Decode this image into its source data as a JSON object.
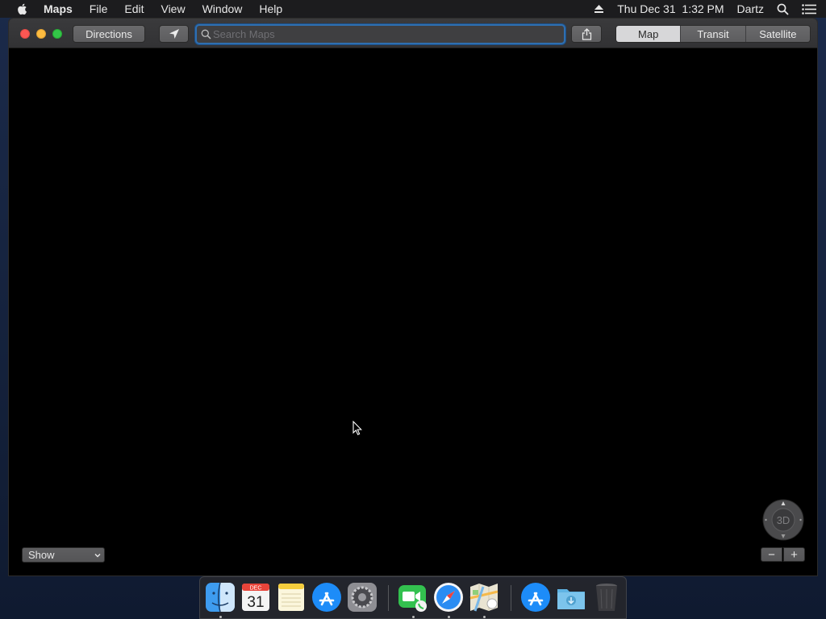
{
  "menubar": {
    "items": [
      "Maps",
      "File",
      "Edit",
      "View",
      "Window",
      "Help"
    ],
    "clock": "Thu Dec 31  1:32 PM",
    "user": "Dartz"
  },
  "toolbar": {
    "directions_label": "Directions",
    "search_placeholder": "Search Maps",
    "search_value": "",
    "view_modes": [
      "Map",
      "Transit",
      "Satellite"
    ],
    "active_view_mode": "Map"
  },
  "map": {
    "show_label": "Show",
    "compass_label": "3D",
    "zoom_out_label": "−",
    "zoom_in_label": "+"
  },
  "dock": {
    "calendar_month": "DEC",
    "calendar_day": "31",
    "apps": [
      "finder",
      "calendar",
      "notes",
      "app-store",
      "system-preferences",
      "facetime",
      "safari",
      "maps",
      "app-store",
      "downloads",
      "trash"
    ]
  },
  "colors": {
    "search_focus_ring": "#2f6fb0",
    "close": "#fc5753",
    "minimize": "#fdbc40",
    "maximize": "#33c748"
  }
}
